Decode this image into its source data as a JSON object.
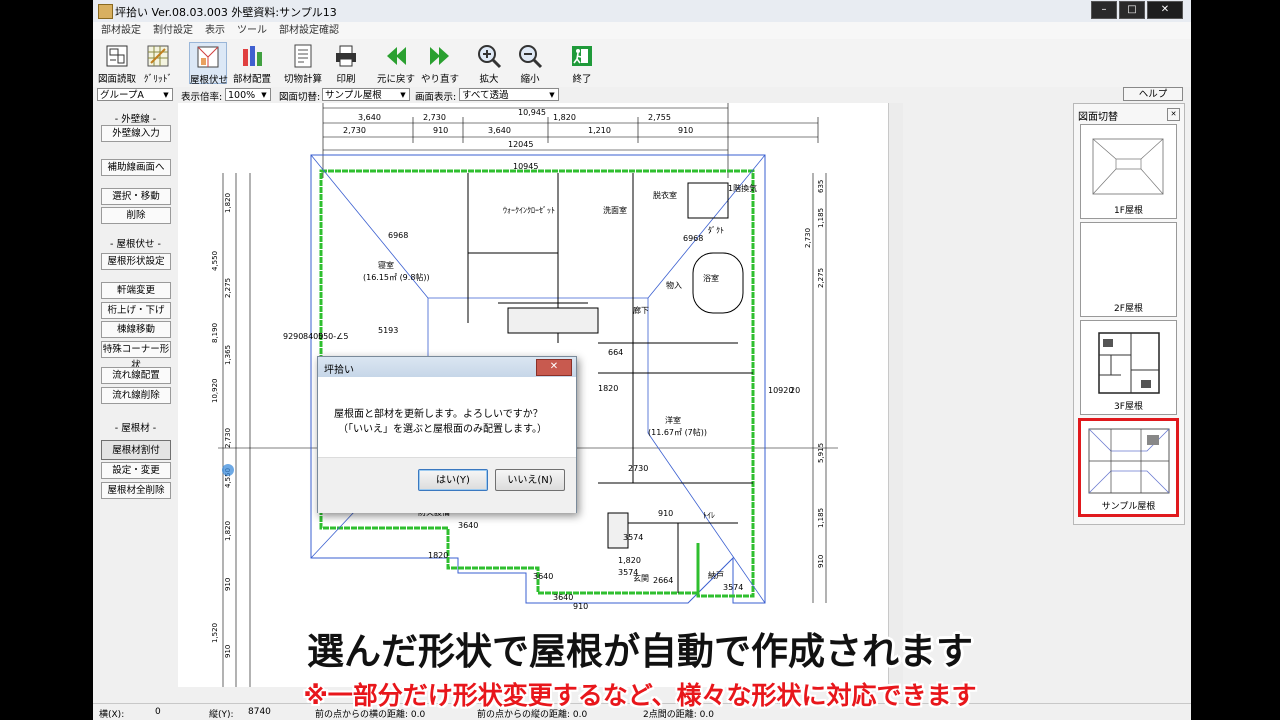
{
  "window": {
    "title": "坪拾い   Ver.08.03.003   外壁資料:サンプル13",
    "controls": [
      "–",
      "□",
      "✕"
    ]
  },
  "menu": [
    "部材設定",
    "割付設定",
    "表示",
    "ツール",
    "部材設定確認"
  ],
  "toolbar": [
    {
      "id": "load",
      "label": "図面読取",
      "icon": "drawing-load-icon"
    },
    {
      "id": "grid",
      "label": "ｸﾞﾘｯﾄﾞ",
      "icon": "grid-icon"
    },
    {
      "id": "roof",
      "label": "屋根伏せ",
      "icon": "roof-plan-icon",
      "pressed": true
    },
    {
      "id": "place",
      "label": "部材配置",
      "icon": "parts-place-icon"
    },
    {
      "id": "calc",
      "label": "切物計算",
      "icon": "cut-calc-icon"
    },
    {
      "id": "print",
      "label": "印刷",
      "icon": "printer-icon"
    },
    {
      "id": "undo",
      "label": "元に戻す",
      "icon": "undo-icon"
    },
    {
      "id": "redo",
      "label": "やり直す",
      "icon": "redo-icon"
    },
    {
      "id": "zoomin",
      "label": "拡大",
      "icon": "zoom-in-icon"
    },
    {
      "id": "zoomout",
      "label": "縮小",
      "icon": "zoom-out-icon"
    },
    {
      "id": "exit",
      "label": "終了",
      "icon": "exit-icon"
    }
  ],
  "selectors": {
    "group": "グループA",
    "scale_label": "表示倍率:",
    "scale": "100%",
    "drawing_label": "図面切替:",
    "drawing": "サンプル屋根",
    "display_label": "画面表示:",
    "display": "すべて透過",
    "help": "ヘルプ"
  },
  "leftpanel": [
    {
      "type": "head",
      "text": "- 外壁線 -"
    },
    {
      "type": "btn",
      "text": "外壁線入力"
    },
    {
      "type": "btn",
      "text": "補助線画面へ"
    },
    {
      "type": "btn",
      "text": "選択・移動"
    },
    {
      "type": "btn",
      "text": "削除"
    },
    {
      "type": "head",
      "text": "- 屋根伏せ -"
    },
    {
      "type": "btn",
      "text": "屋根形状設定"
    },
    {
      "type": "btn",
      "text": "軒端変更"
    },
    {
      "type": "btn",
      "text": "桁上げ・下げ"
    },
    {
      "type": "btn",
      "text": "棟線移動"
    },
    {
      "type": "btn",
      "text": "特殊コーナー形状"
    },
    {
      "type": "btn",
      "text": "流れ線配置"
    },
    {
      "type": "btn",
      "text": "流れ線削除"
    },
    {
      "type": "head",
      "text": "- 屋根材 -"
    },
    {
      "type": "btn",
      "text": "屋根材割付",
      "active": true
    },
    {
      "type": "btn",
      "text": "設定・変更"
    },
    {
      "type": "btn",
      "text": "屋根材全削除"
    }
  ],
  "plan": {
    "dims_top": [
      "10,945",
      "3,640",
      "2,730",
      "1,820",
      "2,755",
      "2,730",
      "910",
      "3,640",
      "1,210",
      "910",
      "12045",
      "10945"
    ],
    "labels": [
      "寝室",
      "(16.15㎡ (9.8帖))",
      "6968",
      "ｳｫｰｸｲﾝｸﾛｰｾﾞｯﾄ",
      "洗面室",
      "脱衣室",
      "1階換気",
      "ﾀﾞｸﾄ",
      "浴室",
      "6968",
      "洋室",
      "(11.67㎡ (7帖))",
      "2730",
      "ﾄｲﾚ",
      "3574",
      "納戸",
      "3574",
      "1820",
      "3640",
      "5193",
      "9290",
      "8400",
      "550-∠5",
      "10920",
      "20",
      "防火設備",
      "物入",
      "廊下",
      "玄関",
      "664",
      "910",
      "1,820",
      "3574",
      "2664",
      "3640",
      "1820",
      "3640",
      "910"
    ],
    "dims_left": [
      "1,820",
      "4,550",
      "2,275",
      "8,190",
      "1,365",
      "10,920",
      "2,730",
      "4,550",
      "1,820",
      "910",
      "1,520",
      "910"
    ],
    "dims_right": [
      "635",
      "1,185",
      "2,730",
      "2,275",
      "5,915",
      "1,185",
      "910"
    ]
  },
  "rightpanel": {
    "title": "図面切替",
    "thumbs": [
      {
        "label": "1F屋根"
      },
      {
        "label": "2F屋根"
      },
      {
        "label": "3F屋根"
      },
      {
        "label": "サンプル屋根",
        "selected": true
      }
    ]
  },
  "dialog": {
    "title": "坪拾い",
    "message1": "屋根面と部材を更新します。よろしいですか？",
    "message2": "（「いいえ」を選ぶと屋根面のみ配置します。）",
    "yes": "はい(Y)",
    "no": "いいえ(N)"
  },
  "status": {
    "x_label": "横(X):",
    "x": "0",
    "y_label": "縦(Y):",
    "y": "8740",
    "prev_x": "前の点からの横の距離:  0.0",
    "prev_y": "前の点からの縦の距離:  0.0",
    "two_point": "2点間の距離:  0.0"
  },
  "subtitle": {
    "main": "選んだ形状で屋根が自動で作成されます",
    "note": "※一部分だけ形状変更するなど、様々な形状に対応できます"
  },
  "colors": {
    "selected_thumb": "#e0191d",
    "wall_green": "#2fbf2f",
    "roof_blue": "#3a5fd0",
    "subtitle_note": "#e8161b"
  }
}
